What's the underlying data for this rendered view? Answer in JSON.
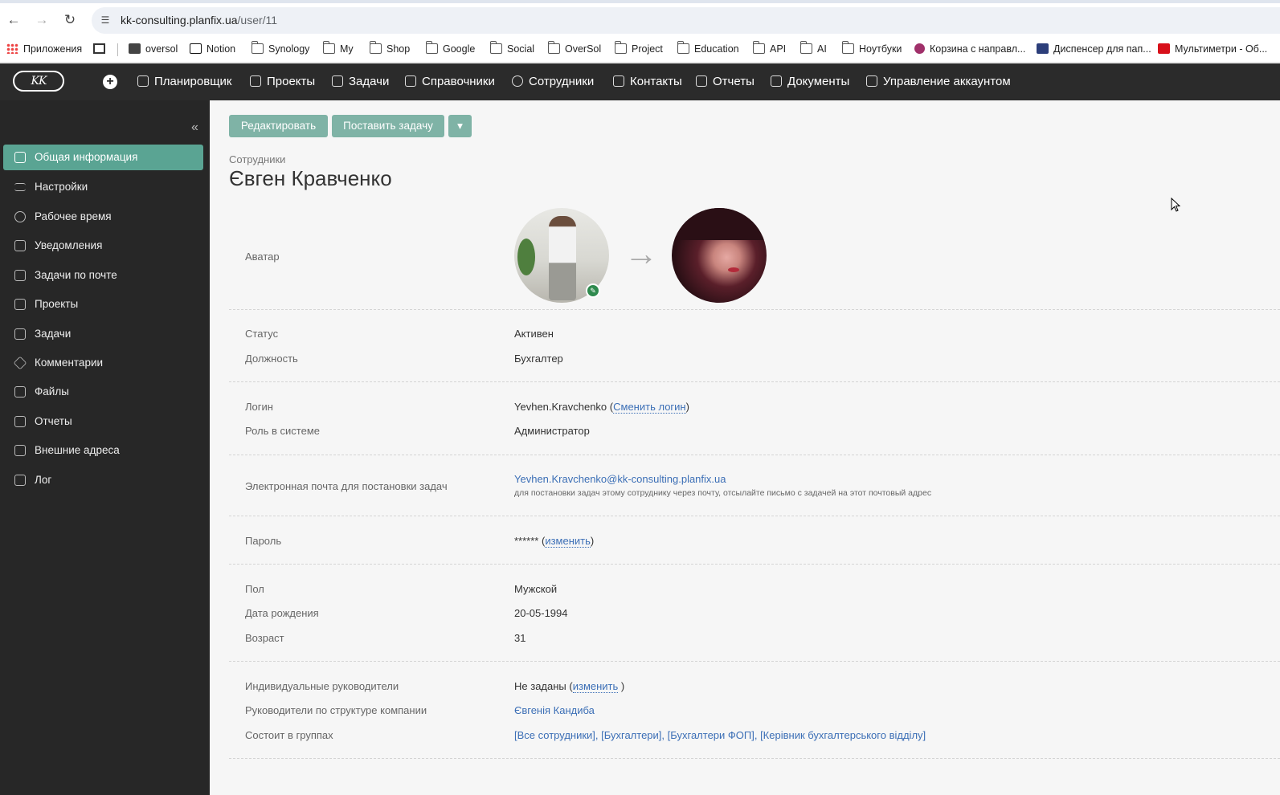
{
  "browser": {
    "url_host": "kk-consulting.planfix.ua",
    "url_path": "/user/11",
    "bookmarks": [
      {
        "label": "Приложения",
        "icon": "apps-grid-icon"
      },
      {
        "label": "",
        "icon": "grid-icon"
      },
      {
        "label": "oversol",
        "icon": "site-icon"
      },
      {
        "label": "Notion",
        "icon": "notion-icon"
      },
      {
        "label": "Synology",
        "icon": "folder-icon"
      },
      {
        "label": "My",
        "icon": "folder-icon"
      },
      {
        "label": "Shop",
        "icon": "folder-icon"
      },
      {
        "label": "Google",
        "icon": "folder-icon"
      },
      {
        "label": "Social",
        "icon": "folder-icon"
      },
      {
        "label": "OverSol",
        "icon": "folder-icon"
      },
      {
        "label": "Project",
        "icon": "folder-icon"
      },
      {
        "label": "Education",
        "icon": "folder-icon"
      },
      {
        "label": "API",
        "icon": "folder-icon"
      },
      {
        "label": "AI",
        "icon": "folder-icon"
      },
      {
        "label": "Ноутбуки",
        "icon": "folder-icon"
      },
      {
        "label": "Корзина с направл...",
        "icon": "site-icon"
      },
      {
        "label": "Диспенсер для пап...",
        "icon": "site-icon"
      },
      {
        "label": "Мультиметри - Об...",
        "icon": "site-icon"
      }
    ]
  },
  "app": {
    "logo_text": "KK",
    "nav": [
      {
        "label": "Планировщик"
      },
      {
        "label": "Проекты"
      },
      {
        "label": "Задачи"
      },
      {
        "label": "Справочники"
      },
      {
        "label": "Сотрудники"
      },
      {
        "label": "Контакты"
      },
      {
        "label": "Отчеты"
      },
      {
        "label": "Документы"
      },
      {
        "label": "Управление аккаунтом"
      }
    ]
  },
  "sidebar": {
    "items": [
      {
        "label": "Общая информация",
        "active": true
      },
      {
        "label": "Настройки"
      },
      {
        "label": "Рабочее время"
      },
      {
        "label": "Уведомления"
      },
      {
        "label": "Задачи по почте"
      },
      {
        "label": "Проекты"
      },
      {
        "label": "Задачи"
      },
      {
        "label": "Комментарии"
      },
      {
        "label": "Файлы"
      },
      {
        "label": "Отчеты"
      },
      {
        "label": "Внешние адреса"
      },
      {
        "label": "Лог"
      }
    ]
  },
  "toolbar": {
    "edit_label": "Редактировать",
    "assign_label": "Поставить задачу",
    "more_label": "▾"
  },
  "page": {
    "breadcrumb": "Сотрудники",
    "title": "Євген Кравченко"
  },
  "fields": {
    "avatar_label": "Аватар",
    "status_label": "Статус",
    "status_value": "Активен",
    "position_label": "Должность",
    "position_value": "Бухгалтер",
    "login_label": "Логин",
    "login_value": "Yevhen.Kravchenko",
    "login_change": "Сменить логин",
    "role_label": "Роль в системе",
    "role_value": "Администратор",
    "email_label": "Электронная почта для постановки задач",
    "email_value": "Yevhen.Kravchenko@kk-consulting.planfix.ua",
    "email_note": "для постановки задач этому сотруднику через почту, отсылайте письмо с задачей на этот почтовый адрес",
    "password_label": "Пароль",
    "password_value": "******",
    "password_change": "изменить",
    "gender_label": "Пол",
    "gender_value": "Мужской",
    "birth_label": "Дата рождения",
    "birth_value": "20-05-1994",
    "age_label": "Возраст",
    "age_value": "31",
    "managers_label": "Индивидуальные руководители",
    "managers_value": "Не заданы",
    "managers_change": "изменить",
    "struct_managers_label": "Руководители по структуре компании",
    "struct_managers_value": "Євгенія Кандиба",
    "groups_label": "Состоит в группах",
    "groups_value": "[Все сотрудники], [Бухгалтери], [Бухгалтери ФОП], [Керівник бухгалтерського відділу]"
  },
  "colors": {
    "accent": "#5aa493",
    "button": "#7fb3a6",
    "nav_bg": "#2b2b2b",
    "link": "#3c6fb6"
  }
}
